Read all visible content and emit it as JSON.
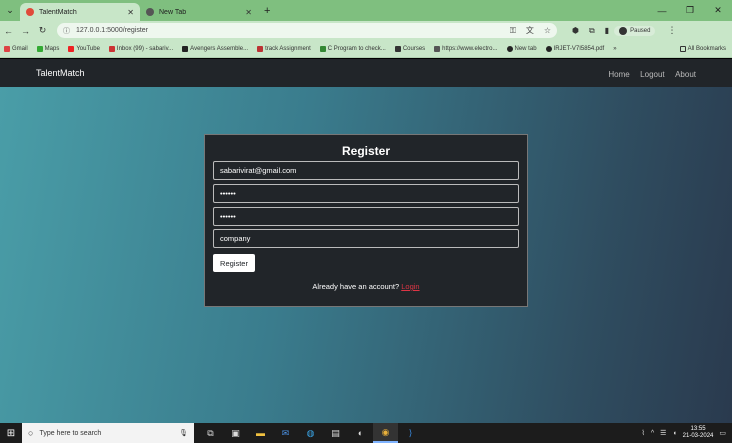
{
  "browser": {
    "tabs": [
      {
        "title": "TalentMatch",
        "active": true
      },
      {
        "title": "New Tab",
        "active": false
      }
    ],
    "url": "127.0.0.1:5000/register",
    "profile_label": "Paused",
    "bookmarks": [
      "Gmail",
      "Maps",
      "YouTube",
      "Inbox (99) - sabariv...",
      "Avengers Assemble...",
      "track Assignment",
      "C Program to check...",
      "Courses",
      "https://www.electro...",
      "New tab",
      "IRJET-V7I5854.pdf"
    ],
    "all_bookmarks_label": "All Bookmarks"
  },
  "navbar": {
    "brand": "TalentMatch",
    "links": [
      "Home",
      "Logout",
      "About"
    ]
  },
  "form": {
    "title": "Register",
    "email_value": "sabarivirat@gmail.com",
    "password_value": "••••••",
    "confirm_value": "••••••",
    "role_value": "company",
    "submit_label": "Register",
    "already_text": "Already have an account?",
    "login_link": "Login"
  },
  "taskbar": {
    "search_placeholder": "Type here to search",
    "time": "13:55",
    "date": "21-03-2024"
  },
  "colors": {
    "navbar_bg": "#212529",
    "login_link": "#dc3545",
    "chrome_frame": "#7fbf7f"
  }
}
